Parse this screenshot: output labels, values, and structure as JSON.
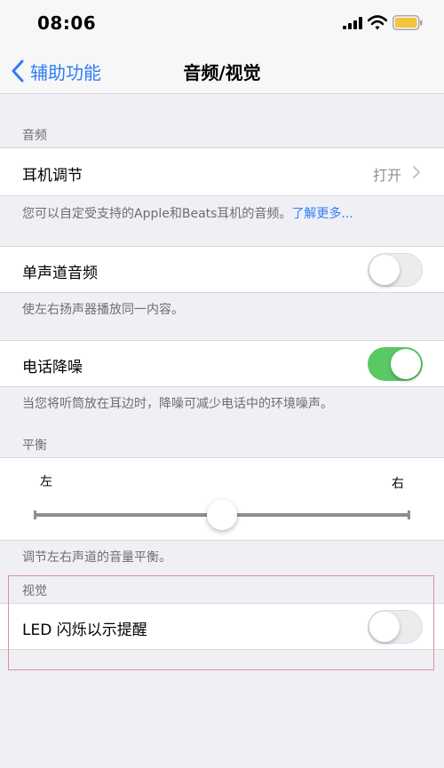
{
  "status_bar": {
    "time": "08:06"
  },
  "nav": {
    "back_label": "辅助功能",
    "title": "音频/视觉"
  },
  "audio_section": {
    "header": "音频",
    "headphone": {
      "label": "耳机调节",
      "value": "打开"
    },
    "headphone_footer": "您可以自定受支持的Apple和Beats耳机的音频。",
    "headphone_footer_link": "了解更多...",
    "mono": {
      "label": "单声道音频",
      "toggle_on": false
    },
    "mono_footer": "使左右扬声器播放同一内容。",
    "noise": {
      "label": "电话降噪",
      "toggle_on": true
    },
    "noise_footer": "当您将听筒放在耳边时，降噪可减少电话中的环境噪声。"
  },
  "balance_section": {
    "header": "平衡",
    "left_label": "左",
    "right_label": "右",
    "balance_fraction": 0.5,
    "footer": "调节左右声道的音量平衡。"
  },
  "visual_section": {
    "header": "视觉",
    "led": {
      "label": "LED 闪烁以示提醒",
      "toggle_on": false
    }
  },
  "colors": {
    "accent": "#2f7df6",
    "toggle_on": "#5ac864",
    "highlight": "#e48ba6",
    "battery": "#f5c33b"
  }
}
